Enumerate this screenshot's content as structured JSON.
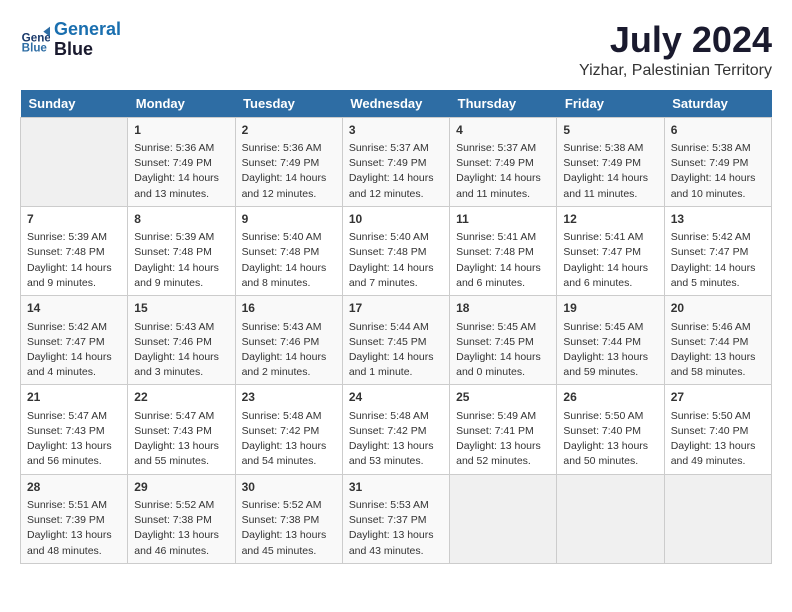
{
  "header": {
    "logo_line1": "General",
    "logo_line2": "Blue",
    "month": "July 2024",
    "location": "Yizhar, Palestinian Territory"
  },
  "days_of_week": [
    "Sunday",
    "Monday",
    "Tuesday",
    "Wednesday",
    "Thursday",
    "Friday",
    "Saturday"
  ],
  "weeks": [
    [
      {
        "day": "",
        "empty": true
      },
      {
        "day": "1",
        "sunrise": "5:36 AM",
        "sunset": "7:49 PM",
        "daylight": "14 hours and 13 minutes."
      },
      {
        "day": "2",
        "sunrise": "5:36 AM",
        "sunset": "7:49 PM",
        "daylight": "14 hours and 12 minutes."
      },
      {
        "day": "3",
        "sunrise": "5:37 AM",
        "sunset": "7:49 PM",
        "daylight": "14 hours and 12 minutes."
      },
      {
        "day": "4",
        "sunrise": "5:37 AM",
        "sunset": "7:49 PM",
        "daylight": "14 hours and 11 minutes."
      },
      {
        "day": "5",
        "sunrise": "5:38 AM",
        "sunset": "7:49 PM",
        "daylight": "14 hours and 11 minutes."
      },
      {
        "day": "6",
        "sunrise": "5:38 AM",
        "sunset": "7:49 PM",
        "daylight": "14 hours and 10 minutes."
      }
    ],
    [
      {
        "day": "7",
        "sunrise": "5:39 AM",
        "sunset": "7:48 PM",
        "daylight": "14 hours and 9 minutes."
      },
      {
        "day": "8",
        "sunrise": "5:39 AM",
        "sunset": "7:48 PM",
        "daylight": "14 hours and 9 minutes."
      },
      {
        "day": "9",
        "sunrise": "5:40 AM",
        "sunset": "7:48 PM",
        "daylight": "14 hours and 8 minutes."
      },
      {
        "day": "10",
        "sunrise": "5:40 AM",
        "sunset": "7:48 PM",
        "daylight": "14 hours and 7 minutes."
      },
      {
        "day": "11",
        "sunrise": "5:41 AM",
        "sunset": "7:48 PM",
        "daylight": "14 hours and 6 minutes."
      },
      {
        "day": "12",
        "sunrise": "5:41 AM",
        "sunset": "7:47 PM",
        "daylight": "14 hours and 6 minutes."
      },
      {
        "day": "13",
        "sunrise": "5:42 AM",
        "sunset": "7:47 PM",
        "daylight": "14 hours and 5 minutes."
      }
    ],
    [
      {
        "day": "14",
        "sunrise": "5:42 AM",
        "sunset": "7:47 PM",
        "daylight": "14 hours and 4 minutes."
      },
      {
        "day": "15",
        "sunrise": "5:43 AM",
        "sunset": "7:46 PM",
        "daylight": "14 hours and 3 minutes."
      },
      {
        "day": "16",
        "sunrise": "5:43 AM",
        "sunset": "7:46 PM",
        "daylight": "14 hours and 2 minutes."
      },
      {
        "day": "17",
        "sunrise": "5:44 AM",
        "sunset": "7:45 PM",
        "daylight": "14 hours and 1 minute."
      },
      {
        "day": "18",
        "sunrise": "5:45 AM",
        "sunset": "7:45 PM",
        "daylight": "14 hours and 0 minutes."
      },
      {
        "day": "19",
        "sunrise": "5:45 AM",
        "sunset": "7:44 PM",
        "daylight": "13 hours and 59 minutes."
      },
      {
        "day": "20",
        "sunrise": "5:46 AM",
        "sunset": "7:44 PM",
        "daylight": "13 hours and 58 minutes."
      }
    ],
    [
      {
        "day": "21",
        "sunrise": "5:47 AM",
        "sunset": "7:43 PM",
        "daylight": "13 hours and 56 minutes."
      },
      {
        "day": "22",
        "sunrise": "5:47 AM",
        "sunset": "7:43 PM",
        "daylight": "13 hours and 55 minutes."
      },
      {
        "day": "23",
        "sunrise": "5:48 AM",
        "sunset": "7:42 PM",
        "daylight": "13 hours and 54 minutes."
      },
      {
        "day": "24",
        "sunrise": "5:48 AM",
        "sunset": "7:42 PM",
        "daylight": "13 hours and 53 minutes."
      },
      {
        "day": "25",
        "sunrise": "5:49 AM",
        "sunset": "7:41 PM",
        "daylight": "13 hours and 52 minutes."
      },
      {
        "day": "26",
        "sunrise": "5:50 AM",
        "sunset": "7:40 PM",
        "daylight": "13 hours and 50 minutes."
      },
      {
        "day": "27",
        "sunrise": "5:50 AM",
        "sunset": "7:40 PM",
        "daylight": "13 hours and 49 minutes."
      }
    ],
    [
      {
        "day": "28",
        "sunrise": "5:51 AM",
        "sunset": "7:39 PM",
        "daylight": "13 hours and 48 minutes."
      },
      {
        "day": "29",
        "sunrise": "5:52 AM",
        "sunset": "7:38 PM",
        "daylight": "13 hours and 46 minutes."
      },
      {
        "day": "30",
        "sunrise": "5:52 AM",
        "sunset": "7:38 PM",
        "daylight": "13 hours and 45 minutes."
      },
      {
        "day": "31",
        "sunrise": "5:53 AM",
        "sunset": "7:37 PM",
        "daylight": "13 hours and 43 minutes."
      },
      {
        "day": "",
        "empty": true
      },
      {
        "day": "",
        "empty": true
      },
      {
        "day": "",
        "empty": true
      }
    ]
  ]
}
